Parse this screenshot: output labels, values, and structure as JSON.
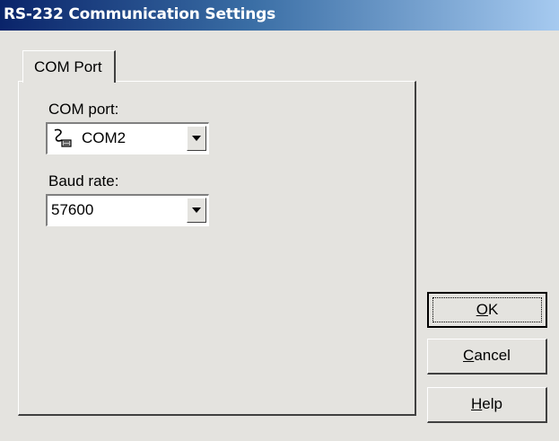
{
  "window": {
    "title": "RS-232 Communication Settings"
  },
  "tabs": [
    {
      "label": "COM Port"
    }
  ],
  "com_port": {
    "label": "COM port:",
    "value": "COM2",
    "icon": "serial-port-icon"
  },
  "baud_rate": {
    "label": "Baud rate:",
    "value": "57600"
  },
  "buttons": {
    "ok": {
      "mnemonic": "O",
      "rest": "K"
    },
    "cancel": {
      "mnemonic": "C",
      "rest": "ancel"
    },
    "help": {
      "mnemonic": "H",
      "rest": "elp"
    }
  }
}
